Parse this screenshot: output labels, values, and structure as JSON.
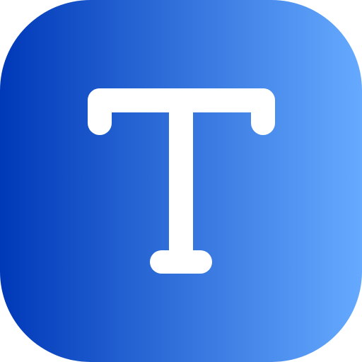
{
  "icon": {
    "name": "text-tool-icon",
    "glyph": "T",
    "colors": {
      "gradient_start": "#0039B8",
      "gradient_end": "#65AAFF",
      "glyph": "#FFFFFF"
    }
  }
}
